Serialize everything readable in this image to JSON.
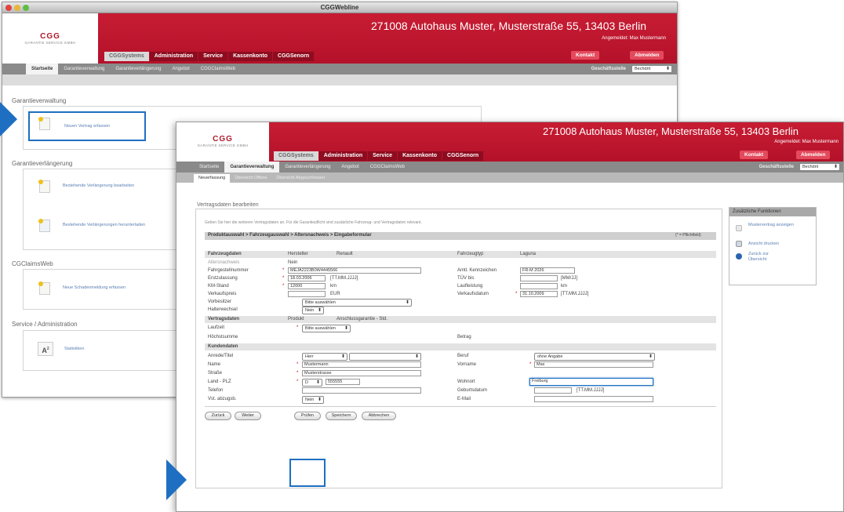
{
  "window1": {
    "title": "CGGWebline",
    "company": "271008 Autohaus Muster, Musterstraße 55, 13403 Berlin",
    "logged_in": "Angemeldet: Max Mustermann",
    "logo_text": "CGG",
    "logo_sub": "GARANTIE SERVICE GMBH",
    "main_nav": [
      "CGGSystems",
      "Administration",
      "Service",
      "Kassenkonto",
      "CGGSenorn"
    ],
    "right_buttons": [
      "Kontakt",
      "Abmelden"
    ],
    "sub_nav": [
      "Startseite",
      "Garantieverwaltung",
      "Garantieverlängerung",
      "Angebot",
      "CGGClaimsWeb"
    ],
    "select_label": "Geschäftsstelle",
    "select_value": "Bechdrit",
    "sections": [
      {
        "title": "Garantieverwaltung",
        "items": [
          "Neuen Vertrag erfassen"
        ]
      },
      {
        "title": "Garantieverlängerung",
        "items": [
          "Bestehende Verlängerung bearbeiten",
          "Bestehende Verlängerungen herunterladen"
        ]
      },
      {
        "title": "CGClaimsWeb",
        "items": [
          "Neue Schadenmeldung erfassen"
        ]
      },
      {
        "title": "Service / Administration",
        "items": [
          "Statistiken"
        ]
      }
    ]
  },
  "window2": {
    "company": "271008 Autohaus Muster, Musterstraße 55, 13403 Berlin",
    "logged_in": "Angemeldet: Max Mustermann",
    "logo_text": "CGG",
    "logo_sub": "GARANTIE SERVICE GMBH",
    "main_nav": [
      "CGGSystems",
      "Administration",
      "Service",
      "Kassenkonto",
      "CGGSenorn"
    ],
    "right_buttons": [
      "Kontakt",
      "Abmelden"
    ],
    "sub_nav": [
      "Startseite",
      "Garantieverwaltung",
      "Garantieverlängerung",
      "Angebot",
      "CGGClaimsWeb"
    ],
    "tabs": [
      "Neuerfassung",
      "Übersicht Offene",
      "Übersicht Abgeschlossen"
    ],
    "select_label": "Geschäftsstelle",
    "select_value": "Bechdrit",
    "section_title": "Vertragsdaten bearbeiten",
    "intro": "Geben Sie hier die weiteren Vertragsdaten an. Für die Garantiepflicht sind zusätzliche Fahrzeug- und Vertragsdaten relevant.",
    "breadcrumb": "Produktauswahl > Fahrzeugauswahl > Altersnachweis > Eingabeformular",
    "breadcrumb_right": "(* = Pflichtfeld)",
    "vehicle": {
      "header": "Fahrzeugdaten",
      "hersteller_label": "Hersteller",
      "hersteller_value": "Renault",
      "fahrzeugtyp_label": "Fahrzeugtyp",
      "fahrzeugtyp_value": "Laguna",
      "alter_label": "Altersnachweis",
      "alter_value": "Nein",
      "fin_label": "Fahrgestellnummer",
      "fin_value": "MEJA2223B0W4445566",
      "kennz_label": "Amtl. Kennzeichen",
      "kennz_value": "FR-M 2026",
      "ez_label": "Erstzulassung",
      "ez_value": "18.03.2006",
      "ez_fmt": "[TT.MM.JJJJ]",
      "tuev_label": "TÜV bis",
      "tuev_fmt": "[MM/JJ]",
      "km_label": "KM-Stand",
      "km_value": "12000",
      "km_unit": "km",
      "laufl_label": "Laufleistung",
      "laufl_unit": "km",
      "vk_label": "Verkaufspreis",
      "vk_unit": "EUR",
      "vkd_label": "Verkaufsdatum",
      "vkd_value": "31.10.2009",
      "vkd_fmt": "[TT.MM.JJJJ]",
      "vorbes_label": "Vorbesitzer",
      "vorbes_value": "Bitte auswählen",
      "halter_label": "Halterwechsel",
      "halter_value": "Nein"
    },
    "contract": {
      "header": "Vertragsdaten",
      "produkt_label": "Produkt",
      "produkt_value": "Anschlussgarantie - Std.",
      "laufzeit_label": "Laufzeit",
      "laufzeit_value": "Bitte auswählen",
      "hoechst_label": "Höchstsumme",
      "betrag_label": "Betrag"
    },
    "customer": {
      "header": "Kundendaten",
      "anrede_label": "Anrede/Titel",
      "anrede_value": "Herr",
      "beruf_label": "Beruf",
      "beruf_value": "ohne Angabe",
      "name_label": "Name",
      "name_value": "Mustermann",
      "vorname_label": "Vorname",
      "vorname_value": "Max",
      "strasse_label": "Straße",
      "strasse_value": "Musterstrasse",
      "land_label": "Land - PLZ",
      "land_value": "D",
      "plz_value": "555555",
      "wohnort_label": "Wohnort",
      "wohnort_value": "Freiburg",
      "telefon_label": "Telefon",
      "geb_label": "Geburtsdatum",
      "geb_fmt": "[TT.MM.JJJJ]",
      "vst_label": "Vst. abzugsb.",
      "vst_value": "Nein",
      "email_label": "E-Mail"
    },
    "buttons": [
      "Zurück",
      "Weiter",
      "Prüfen",
      "Speichern",
      "Abbrechen"
    ],
    "side": {
      "header": "Zusätzliche Funktionen",
      "items": [
        "Mustervertrag anzeigen",
        "Ansicht drucken",
        "Zurück zur Übersicht"
      ]
    }
  },
  "colors": {
    "brand_red": "#c8102e",
    "highlight_blue": "#1e6fc1",
    "link_blue": "#5a7fb3"
  }
}
